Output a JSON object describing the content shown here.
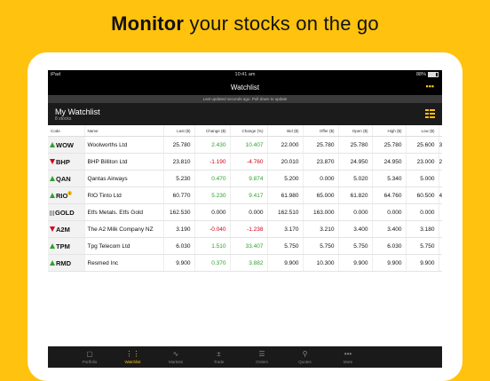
{
  "headline": {
    "bold": "Monitor",
    "rest": " your stocks on the go"
  },
  "status": {
    "device": "iPad",
    "time": "10:41 am",
    "battery": "88%"
  },
  "nav": {
    "title": "Watchlist",
    "more": "•••"
  },
  "updated_text": "Last updated seconds ago. Pull down to update",
  "watchlist": {
    "name": "My Watchlist",
    "count": "8 stocks"
  },
  "columns": [
    "Code",
    "Name",
    "Last ($)",
    "Change ($)",
    "Change (%)",
    "Bid ($)",
    "Offer ($)",
    "Open ($)",
    "High ($)",
    "Low ($)"
  ],
  "rows": [
    {
      "dir": "up",
      "code": "WOW",
      "name": "Woolworths Ltd",
      "last": "25.780",
      "chg": "2.430",
      "pct": "10.407",
      "bid": "22.000",
      "offer": "25.780",
      "open": "25.780",
      "high": "25.780",
      "low": "25.600",
      "cut": "3"
    },
    {
      "dir": "down",
      "code": "BHP",
      "name": "BHP Billiton Ltd",
      "last": "23.810",
      "chg": "-1.190",
      "pct": "-4.760",
      "bid": "20.010",
      "offer": "23.870",
      "open": "24.950",
      "high": "24.950",
      "low": "23.000",
      "cut": "2"
    },
    {
      "dir": "up",
      "code": "QAN",
      "name": "Qantas Airways",
      "last": "5.230",
      "chg": "0.470",
      "pct": "9.874",
      "bid": "5.200",
      "offer": "0.000",
      "open": "5.020",
      "high": "5.340",
      "low": "5.000",
      "cut": ""
    },
    {
      "dir": "up",
      "code": "RIO",
      "badge": "!",
      "name": "RIO Tinto Ltd",
      "last": "60.770",
      "chg": "5.230",
      "pct": "9.417",
      "bid": "61.980",
      "offer": "65.000",
      "open": "61.820",
      "high": "64.760",
      "low": "60.500",
      "cut": "4"
    },
    {
      "dir": "flat",
      "code": "GOLD",
      "name": "Etfs Metals. Etfs Gold",
      "last": "162.530",
      "chg": "0.000",
      "pct": "0.000",
      "bid": "162.510",
      "offer": "163.000",
      "open": "0.000",
      "high": "0.000",
      "low": "0.000",
      "cut": ""
    },
    {
      "dir": "down",
      "code": "A2M",
      "name": "The A2 Milk Company NZ",
      "last": "3.190",
      "chg": "-0.040",
      "pct": "-1.238",
      "bid": "3.170",
      "offer": "3.210",
      "open": "3.400",
      "high": "3.400",
      "low": "3.180",
      "cut": ""
    },
    {
      "dir": "up",
      "code": "TPM",
      "name": "Tpg Telecom Ltd",
      "last": "6.030",
      "chg": "1.510",
      "pct": "33.407",
      "bid": "5.750",
      "offer": "5.750",
      "open": "5.750",
      "high": "6.030",
      "low": "5.750",
      "cut": ""
    },
    {
      "dir": "up",
      "code": "RMD",
      "name": "Resmed Inc",
      "last": "9.900",
      "chg": "0.370",
      "pct": "3.882",
      "bid": "9.900",
      "offer": "10.300",
      "open": "9.900",
      "high": "9.900",
      "low": "9.900",
      "cut": ""
    }
  ],
  "tabs": [
    {
      "label": "Portfolio",
      "icon": "portfolio-icon",
      "glyph": "▢"
    },
    {
      "label": "Watchlist",
      "icon": "watchlist-icon",
      "glyph": "⋮⋮",
      "active": true
    },
    {
      "label": "Markets",
      "icon": "markets-icon",
      "glyph": "∿"
    },
    {
      "label": "Trade",
      "icon": "trade-icon",
      "glyph": "±"
    },
    {
      "label": "Orders",
      "icon": "orders-icon",
      "glyph": "☰"
    },
    {
      "label": "Quotes",
      "icon": "quotes-icon",
      "glyph": "⚲"
    },
    {
      "label": "More",
      "icon": "more-icon",
      "glyph": "•••"
    }
  ],
  "colors": {
    "accent": "#FFC20E",
    "up": "#2ea12e",
    "down": "#d0021b"
  }
}
